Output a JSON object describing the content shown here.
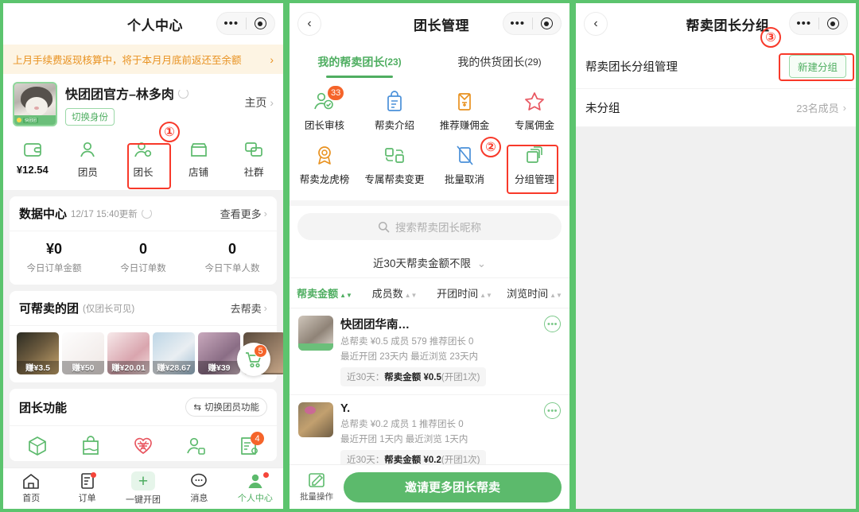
{
  "panel1": {
    "nav": {
      "title": "个人中心",
      "dots": "•••",
      "target_icon": "target-icon"
    },
    "banner": {
      "text": "上月手续费返现核算中，将于本月月底前返还至余额",
      "arrow": "›"
    },
    "profile": {
      "name": "快团团官方–林多肉",
      "switch_identity": "切换身份",
      "homepage": "主页",
      "homepage_arrow": "›"
    },
    "quick": [
      {
        "icon": "wallet-icon",
        "label": "¥12.54"
      },
      {
        "icon": "member-icon",
        "label": "团员"
      },
      {
        "icon": "leader-icon",
        "label": "团长"
      },
      {
        "icon": "shop-icon",
        "label": "店铺"
      },
      {
        "icon": "community-icon",
        "label": "社群"
      }
    ],
    "data_center": {
      "title": "数据中心",
      "updated": "12/17 15:40更新",
      "more": "查看更多",
      "more_arrow": "›",
      "stats": [
        {
          "value": "¥0",
          "label": "今日订单金额"
        },
        {
          "value": "0",
          "label": "今日订单数"
        },
        {
          "value": "0",
          "label": "今日下单人数"
        }
      ]
    },
    "resell": {
      "title": "可帮卖的团",
      "subtitle": "(仅团长可见)",
      "action": "去帮卖",
      "action_arrow": "›",
      "items": [
        {
          "earn": "赚¥3.5"
        },
        {
          "earn": "赚¥50"
        },
        {
          "earn": "赚¥20.01"
        },
        {
          "earn": "赚¥28.67"
        },
        {
          "earn": "赚¥39"
        },
        {
          "earn": ""
        }
      ],
      "cart_badge": "5"
    },
    "functions": {
      "title": "团长功能",
      "switch": "切换团员功能",
      "switch_icon": "swap-icon",
      "items": [
        {
          "icon": "box-icon"
        },
        {
          "icon": "bag-icon"
        },
        {
          "icon": "heart-icon"
        },
        {
          "icon": "person-tag-icon"
        },
        {
          "icon": "order-doc-icon",
          "badge": "4"
        }
      ]
    },
    "tabbar": [
      {
        "icon": "home-icon",
        "label": "首页",
        "active": false
      },
      {
        "icon": "order-icon",
        "label": "订单",
        "active": false,
        "dot": true
      },
      {
        "icon": "plus-icon",
        "label": "一键开团",
        "active": false
      },
      {
        "icon": "message-icon",
        "label": "消息",
        "active": false
      },
      {
        "icon": "profile-icon",
        "label": "个人中心",
        "active": true,
        "dot": true
      }
    ],
    "annotation": {
      "number": "①"
    }
  },
  "panel2": {
    "nav": {
      "back_icon": "back-chevron-icon",
      "title": "团长管理",
      "dots": "•••"
    },
    "tabs": [
      {
        "label": "我的帮卖团长",
        "count": "(23)",
        "active": true
      },
      {
        "label": "我的供货团长",
        "count": "(29)",
        "active": false
      }
    ],
    "grid": [
      {
        "icon": "leader-audit-icon",
        "label": "团长审核",
        "badge": "33"
      },
      {
        "icon": "resell-intro-icon",
        "label": "帮卖介绍"
      },
      {
        "icon": "recommend-commission-icon",
        "label": "推荐赚佣金"
      },
      {
        "icon": "exclusive-commission-icon",
        "label": "专属佣金"
      },
      {
        "icon": "resell-ranking-icon",
        "label": "帮卖龙虎榜"
      },
      {
        "icon": "exclusive-change-icon",
        "label": "专属帮卖变更"
      },
      {
        "icon": "batch-cancel-icon",
        "label": "批量取消"
      },
      {
        "icon": "group-manage-icon",
        "label": "分组管理"
      }
    ],
    "search": {
      "placeholder": "搜索帮卖团长昵称",
      "icon": "search-icon"
    },
    "filter": {
      "label": "近30天帮卖金额不限",
      "chevron": "⌄"
    },
    "sorts": [
      {
        "label": "帮卖金额",
        "active": true
      },
      {
        "label": "成员数",
        "active": false
      },
      {
        "label": "开团时间",
        "active": false
      },
      {
        "label": "浏览时间",
        "active": false
      }
    ],
    "list": [
      {
        "name": "快团团华南…",
        "meta1": "总帮卖 ¥0.5  成员 579  推荐团长 0",
        "meta2": "最近开团 23天内  最近浏览 23天内",
        "tag_prefix": "近30天：",
        "tag_value": "帮卖金额 ¥0.5",
        "tag_suffix": "(开团1次)",
        "more_icon": "more-bubble-icon"
      },
      {
        "name": "Y.",
        "meta1": "总帮卖 ¥0.2  成员 1  推荐团长 0",
        "meta2": "最近开团 1天内  最近浏览 1天内",
        "tag_prefix": "近30天：",
        "tag_value": "帮卖金额 ¥0.2",
        "tag_suffix": "(开团1次)",
        "more_icon": "more-bubble-icon"
      }
    ],
    "bottom": {
      "batch_icon": "batch-edit-icon",
      "batch_label": "批量操作",
      "invite_label": "邀请更多团长帮卖"
    },
    "annotation": {
      "number": "②"
    }
  },
  "panel3": {
    "nav": {
      "back_icon": "back-chevron-icon",
      "title": "帮卖团长分组",
      "dots": "•••"
    },
    "manage_row": {
      "title": "帮卖团长分组管理",
      "button": "新建分组"
    },
    "group_row": {
      "name": "未分组",
      "count": "23名成员",
      "arrow": "›"
    },
    "annotation": {
      "number": "③"
    }
  },
  "colors": {
    "brand_green": "#5cc46e",
    "accent_green": "#4fae61",
    "banner_bg": "#fdf4e3",
    "banner_text": "#e8911f",
    "badge_orange": "#f5642a",
    "annotation_red": "#f8392a",
    "icon_blue": "#4a90d9",
    "icon_red": "#e8555f",
    "icon_orange": "#e8911f"
  }
}
